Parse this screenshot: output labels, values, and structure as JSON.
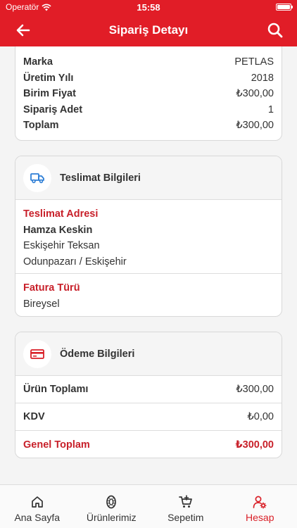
{
  "status_bar": {
    "carrier": "Operatör",
    "time": "15:58"
  },
  "navbar": {
    "title": "Sipariş Detayı"
  },
  "product": {
    "rows": [
      {
        "label": "Marka",
        "value": "PETLAS"
      },
      {
        "label": "Üretim Yılı",
        "value": "2018"
      },
      {
        "label": "Birim Fiyat",
        "value": "₺300,00"
      },
      {
        "label": "Sipariş Adet",
        "value": "1"
      },
      {
        "label": "Toplam",
        "value": "₺300,00"
      }
    ]
  },
  "delivery": {
    "title": "Teslimat Bilgileri",
    "address_label": "Teslimat Adresi",
    "name": "Hamza Keskin",
    "address_line1": "Eskişehir Teksan",
    "address_line2": "Odunpazarı / Eskişehir",
    "invoice_label": "Fatura Türü",
    "invoice_type": "Bireysel"
  },
  "payment": {
    "title": "Ödeme Bilgileri",
    "rows": [
      {
        "label": "Ürün Toplamı",
        "value": "₺300,00"
      },
      {
        "label": "KDV",
        "value": "₺0,00"
      },
      {
        "label": "Genel Toplam",
        "value": "₺300,00"
      }
    ]
  },
  "tabs": [
    {
      "label": "Ana Sayfa",
      "icon": "home-icon"
    },
    {
      "label": "Ürünlerimiz",
      "icon": "tire-icon"
    },
    {
      "label": "Sepetim",
      "icon": "cart-icon"
    },
    {
      "label": "Hesap",
      "icon": "account-settings-icon"
    }
  ],
  "colors": {
    "primary": "#e11d27",
    "accent_text": "#c8202a",
    "delivery_icon": "#2f7fd6"
  }
}
